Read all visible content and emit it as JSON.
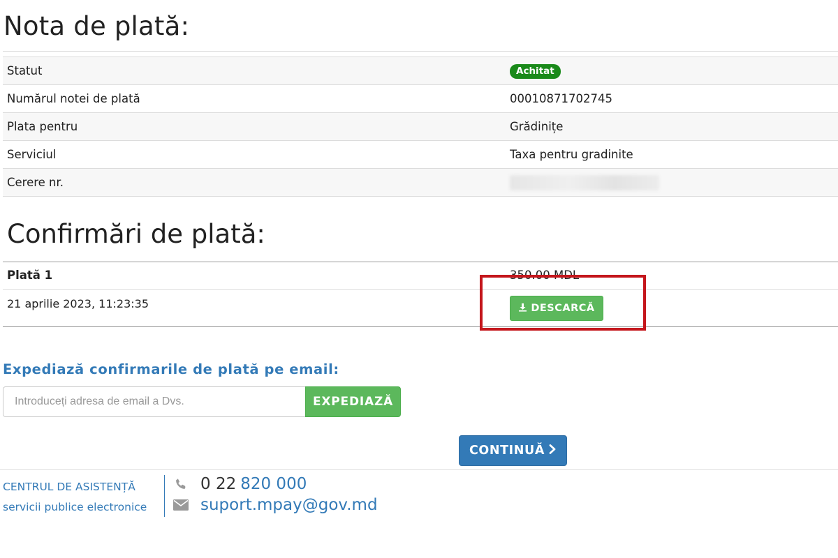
{
  "invoice": {
    "title": "Nota de plată:",
    "rows": [
      {
        "label": "Statut",
        "value": "Achitat",
        "type": "badge"
      },
      {
        "label": "Numărul notei de plată",
        "value": "00010871702745"
      },
      {
        "label": "Plata pentru",
        "value": "Grădinițe"
      },
      {
        "label": "Serviciul",
        "value": "Taxa pentru gradinite"
      },
      {
        "label": "Cerere nr.",
        "value": "",
        "type": "blurred"
      }
    ]
  },
  "confirmations": {
    "title": "Confirmări de plată:",
    "payment": {
      "name": "Plată 1",
      "amount": "350.00 MDL",
      "date": "21 aprilie 2023, 11:23:35",
      "download_label": "DESCARCĂ"
    }
  },
  "email_section": {
    "title": "Expediază confirmarile de plată pe email:",
    "placeholder": "Introduceți adresa de email a Dvs.",
    "send_label": "EXPEDIAZĂ"
  },
  "continue_label": "CONTINUĂ",
  "footer": {
    "support_line1": "CENTRUL DE ASISTENȚĂ",
    "support_line2": "servicii publice electronice",
    "phone_prefix": "0 22",
    "phone_number": "820 000",
    "email": "suport.mpay@gov.md"
  },
  "colors": {
    "badge_green": "#1a8a1a",
    "button_green": "#5cb85c",
    "primary_blue": "#337ab7",
    "highlight_red": "#c4161c"
  },
  "icons": {
    "download": "download-icon",
    "chevron": "chevron-right-icon",
    "phone": "phone-icon",
    "mail": "envelope-icon"
  }
}
